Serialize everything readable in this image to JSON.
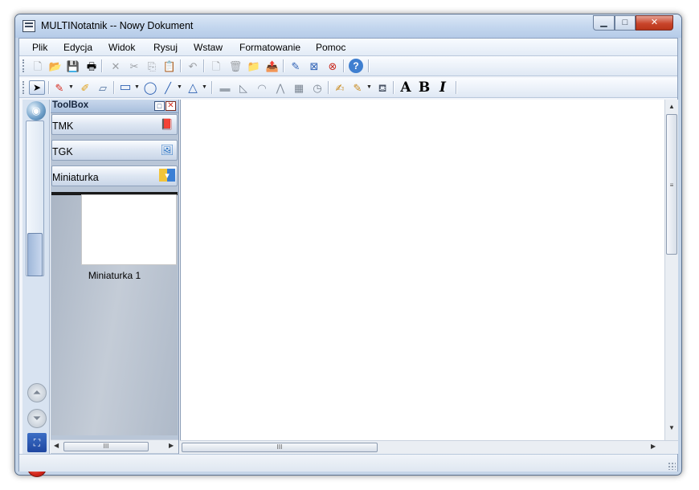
{
  "window": {
    "title": "MULTINotatnik  -- Nowy Dokument"
  },
  "window_buttons": {
    "minimize": "▁",
    "maximize": "□",
    "close": "✕"
  },
  "menu": [
    "Plik",
    "Edycja",
    "Widok",
    "Rysuj",
    "Wstaw",
    "Formatowanie",
    "Pomoc"
  ],
  "toolbar1": [
    {
      "icon": "new-document-icon",
      "glyph": "🗋",
      "disabled": true
    },
    {
      "icon": "open-icon",
      "glyph": "📂",
      "disabled": false
    },
    {
      "icon": "save-icon",
      "glyph": "💾",
      "disabled": false
    },
    {
      "icon": "print-icon",
      "glyph": "🖶",
      "disabled": false
    },
    {
      "icon": "delete-icon",
      "glyph": "✕",
      "disabled": true
    },
    {
      "icon": "cut-icon",
      "glyph": "✂",
      "disabled": true
    },
    {
      "icon": "copy-icon",
      "glyph": "⎘",
      "disabled": true
    },
    {
      "icon": "paste-icon",
      "glyph": "📋",
      "disabled": false
    },
    {
      "icon": "undo-icon",
      "glyph": "↶",
      "disabled": true
    },
    {
      "icon": "new-page-icon",
      "glyph": "🗋",
      "disabled": true
    },
    {
      "icon": "delete-page-icon",
      "glyph": "🗑",
      "disabled": true
    },
    {
      "icon": "add-folder-icon",
      "glyph": "📁",
      "disabled": false
    },
    {
      "icon": "export-icon",
      "glyph": "📤",
      "disabled": false
    },
    {
      "icon": "pencil-icon",
      "glyph": "✎",
      "disabled": false
    },
    {
      "icon": "select-area-icon",
      "glyph": "⊠",
      "disabled": false
    },
    {
      "icon": "remove-icon",
      "glyph": "⊗",
      "disabled": false
    },
    {
      "icon": "help-icon",
      "glyph": "?",
      "disabled": false
    }
  ],
  "toolbar2": [
    {
      "icon": "pointer-icon",
      "glyph": "➤"
    },
    {
      "icon": "pen-icon",
      "glyph": "✎"
    },
    {
      "icon": "highlighter-icon",
      "glyph": "✐"
    },
    {
      "icon": "eraser-icon",
      "glyph": "▱"
    },
    {
      "icon": "rectangle-icon",
      "glyph": "▭"
    },
    {
      "icon": "ellipse-icon",
      "glyph": "◯"
    },
    {
      "icon": "line-icon",
      "glyph": "╱"
    },
    {
      "icon": "triangle-icon",
      "glyph": "△"
    },
    {
      "icon": "ruler-icon",
      "glyph": "▬"
    },
    {
      "icon": "set-square-icon",
      "glyph": "◺"
    },
    {
      "icon": "protractor-icon",
      "glyph": "◠"
    },
    {
      "icon": "compass-icon",
      "glyph": "⋀"
    },
    {
      "icon": "calculator-icon",
      "glyph": "▦"
    },
    {
      "icon": "clock-icon",
      "glyph": "◷"
    },
    {
      "icon": "edit-text-icon",
      "glyph": "✍"
    },
    {
      "icon": "fill-color-icon",
      "glyph": "✎"
    },
    {
      "icon": "paint-bucket-icon",
      "glyph": "⛾"
    },
    {
      "icon": "bold-a-icon",
      "glyph": "A"
    },
    {
      "icon": "bold-b-icon",
      "glyph": "B"
    },
    {
      "icon": "italic-i-icon",
      "glyph": "I"
    }
  ],
  "toolbox": {
    "title": "ToolBox",
    "pin": "□",
    "close": "✕",
    "sections": [
      {
        "label": "TMK",
        "icon": "book-icon",
        "glyph": "📕"
      },
      {
        "label": "TGK",
        "icon": "picture-icon",
        "glyph": "🖼"
      },
      {
        "label": "Miniaturka",
        "icon": "thumbnail-dropdown-icon",
        "glyph": "▾"
      }
    ],
    "thumbnails": [
      {
        "label": "Miniaturka 1"
      }
    ]
  },
  "leftstrip": {
    "up": "⏶",
    "down": "⏷",
    "fullscreen": "⛶",
    "exit": "✕",
    "sphere": "◉"
  },
  "scroll": {
    "left_arrow": "◀",
    "right_arrow": "▶",
    "up_arrow": "▲",
    "down_arrow": "▼",
    "grip": "III",
    "vgrip": "≡"
  },
  "colors": {
    "accent": "#3c6ec5",
    "close": "#c9452b"
  }
}
